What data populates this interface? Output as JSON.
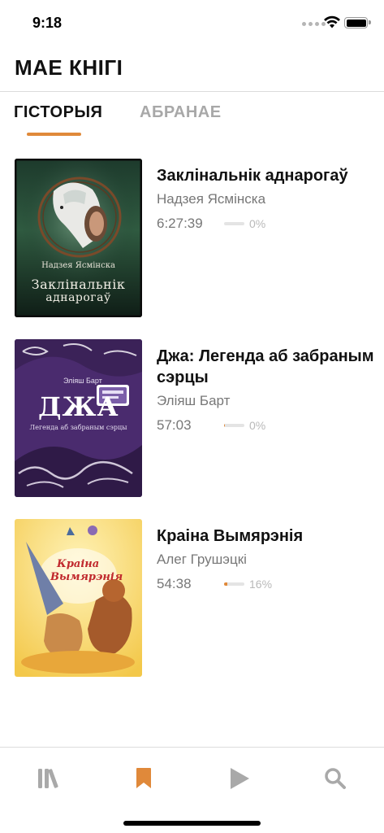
{
  "status_bar": {
    "time": "9:18"
  },
  "header": {
    "title": "МАЕ КНІГІ"
  },
  "tabs": [
    {
      "label": "ГІСТОРЫЯ",
      "active": true
    },
    {
      "label": "АБРАНАЕ",
      "active": false
    }
  ],
  "accent_color": "#e0893a",
  "books": [
    {
      "title": "Заклінальнік аднарогаў",
      "author": "Надзея Ясмінска",
      "duration": "6:27:39",
      "progress": 0,
      "progress_label": "0%",
      "cover": {
        "author_text": "Надзея Ясмінска",
        "title_line1": "Заклінальнік",
        "title_line2": "аднарогаў"
      }
    },
    {
      "title": "Джа: Легенда аб забраным сэрцы",
      "author": "Эліяш Барт",
      "duration": "57:03",
      "progress": 0.02,
      "progress_label": "0%",
      "cover": {
        "author_text": "Эліяш Барт",
        "title_line1": "ДЖА",
        "title_line2": "Легенда аб забраным сэрцы"
      }
    },
    {
      "title": "Краіна Вымярэнія",
      "author": "Алег Грушэцкі",
      "duration": "54:38",
      "progress": 0.16,
      "progress_label": "16%",
      "cover": {
        "title_line1": "Краіна",
        "title_line2": "Вымярэнія"
      }
    }
  ],
  "tab_bar": {
    "items": [
      {
        "icon": "library-icon",
        "active": false
      },
      {
        "icon": "bookmark-icon",
        "active": true
      },
      {
        "icon": "play-icon",
        "active": false
      },
      {
        "icon": "search-icon",
        "active": false
      }
    ]
  }
}
